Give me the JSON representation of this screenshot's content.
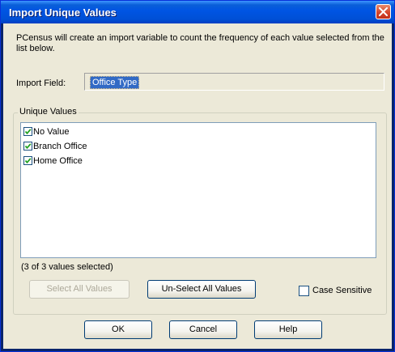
{
  "window": {
    "title": "Import Unique Values"
  },
  "description": "PCensus will create an import variable to count the frequency of each value selected from the list below.",
  "import_field": {
    "label": "Import Field:",
    "value": "Office Type"
  },
  "unique_values": {
    "group_label": "Unique Values",
    "items": [
      {
        "label": "No Value",
        "checked": true
      },
      {
        "label": "Branch Office",
        "checked": true
      },
      {
        "label": "Home Office",
        "checked": true
      }
    ],
    "selection_status": "(3 of 3 values selected)"
  },
  "buttons": {
    "select_all": "Select All Values",
    "unselect_all": "Un-Select All Values",
    "ok": "OK",
    "cancel": "Cancel",
    "help": "Help"
  },
  "case_sensitive": {
    "label": "Case Sensitive",
    "checked": false
  }
}
